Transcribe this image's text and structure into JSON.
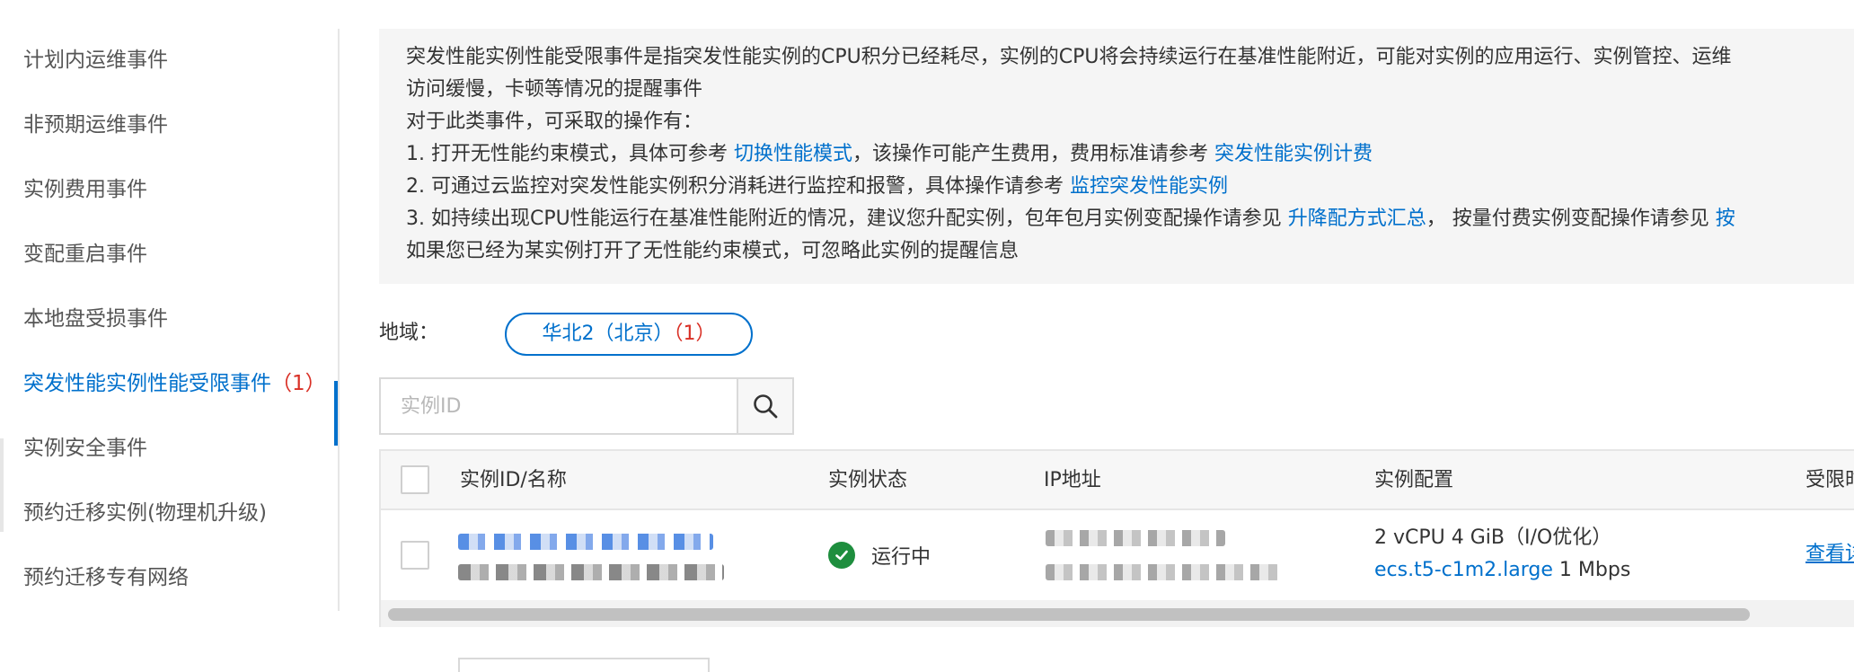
{
  "sidebar": {
    "items": [
      {
        "label": "计划内运维事件"
      },
      {
        "label": "非预期运维事件"
      },
      {
        "label": "实例费用事件"
      },
      {
        "label": "变配重启事件"
      },
      {
        "label": "本地盘受损事件"
      },
      {
        "label": "突发性能实例性能受限事件",
        "count": "（1）"
      },
      {
        "label": "实例安全事件"
      },
      {
        "label": "预约迁移实例(物理机升级)"
      },
      {
        "label": "预约迁移专有网络"
      }
    ],
    "active_index": 5
  },
  "notice": {
    "line1": "突发性能实例性能受限事件是指突发性能实例的CPU积分已经耗尽，实例的CPU将会持续运行在基准性能附近，可能对实例的应用运行、实例管控、运维",
    "line2": "访问缓慢，卡顿等情况的提醒事件",
    "line3": "对于此类事件，可采取的操作有：",
    "line4_text": "1. 打开无性能约束模式，具体可参考 ",
    "line4_link1": "切换性能模式",
    "line4_mid": "，该操作可能产生费用，费用标准请参考 ",
    "line4_link2": "突发性能实例计费",
    "line5_text": "2. 可通过云监控对突发性能实例积分消耗进行监控和报警，具体操作请参考 ",
    "line5_link": "监控突发性能实例",
    "line6_text": "3. 如持续出现CPU性能运行在基准性能附近的情况，建议您升配实例，包年包月实例变配操作请参见 ",
    "line6_link1": "升降配方式汇总",
    "line6_mid": "，  按量付费实例变配操作请参见 ",
    "line6_link2": "按",
    "line7": "如果您已经为某实例打开了无性能约束模式，可忽略此实例的提醒信息"
  },
  "region": {
    "label": "地域：",
    "selected": "华北2（北京）",
    "count": "（1）"
  },
  "search": {
    "placeholder": "实例ID"
  },
  "table": {
    "headers": {
      "id_name": "实例ID/名称",
      "status": "实例状态",
      "ip": "IP地址",
      "config": "实例配置",
      "limit": "受限时"
    },
    "rows": [
      {
        "status": "运行中",
        "config_line1": "2 vCPU 4 GiB（I/O优化）",
        "instance_type": "ecs.t5-c1m2.large",
        "bandwidth": " 1 Mbps",
        "action": "查看详"
      }
    ]
  },
  "colors": {
    "accent": "#0070cc",
    "count_red": "#d93026",
    "status_green": "#1e8e3e"
  },
  "icons": {
    "search": "magnifier-icon",
    "status": "check-circle-icon"
  }
}
